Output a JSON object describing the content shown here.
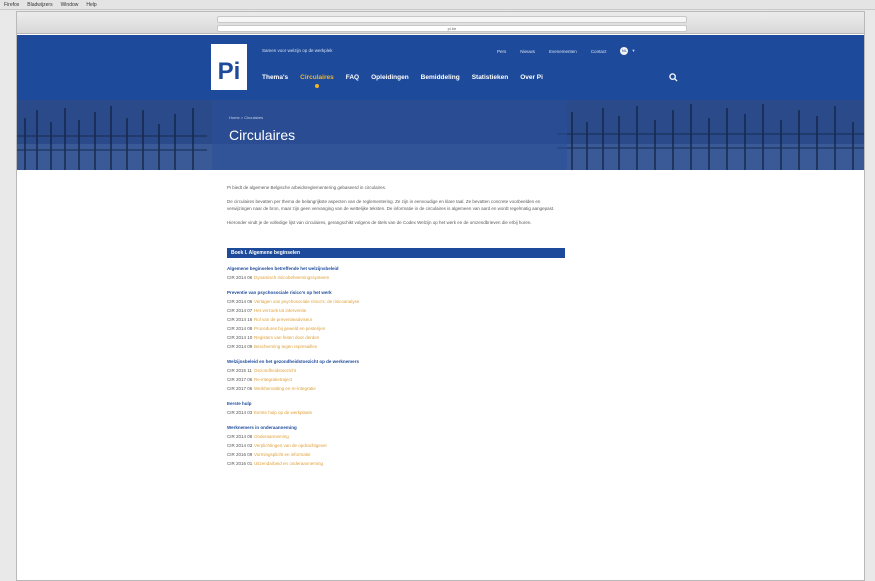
{
  "menubar": {
    "items": [
      "Firefox",
      "Bladwijzers",
      "Window",
      "Help"
    ]
  },
  "browser": {
    "url": "pi.be"
  },
  "header": {
    "logo": "Pi",
    "tagline": "Samen voor welzijn op de werkplek",
    "util_links": [
      "Pers",
      "Nieuws",
      "Evenementen",
      "Contact"
    ],
    "lang": "NL",
    "nav": [
      "Thema's",
      "Circulaires",
      "FAQ",
      "Opleidingen",
      "Bemiddeling",
      "Statistieken",
      "Over Pi"
    ],
    "active_index": 1
  },
  "hero": {
    "breadcrumb": "Home > Circulaires",
    "title": "Circulaires"
  },
  "intro": [
    "Pi biedt de algemene Belgische arbeidsreglementering gebaseerd in circulaires.",
    "De circulaires bevatten per thema de belangrijkste aspecten van de reglementering. Ze zijn in eenvoudige en klare taal. Ze bevatten concrete voorbeelden en verwijzingen naar de bron, maar zijn geen vervanging van de wettelijke teksten. De informatie in de circulaires is algemeen van aard en wordt regelmatig aangepast.",
    "Hieronder vindt je de volledige lijst van circulaires, gerangschikt volgens de titels van de Codex Welzijn op het werk en de omzendbrieven die erbij horen."
  ],
  "book": "Boek I. Algemene beginselen",
  "sections": [
    {
      "title": "Algemene beginselen betreffende het welzijnsbeleid",
      "rows": [
        {
          "code": "CIR 2014 06",
          "text": "Dynamisch risicobeheersingssysteem"
        }
      ]
    },
    {
      "title": "Preventie van psychosociale risico's op het werk",
      "rows": [
        {
          "code": "CIR 2014 06",
          "text": "Verlagen van psychosociale risico's: de risicoanalyse"
        },
        {
          "code": "CIR 2014 07",
          "text": "Het verzoek tot interventie"
        },
        {
          "code": "CIR 2014 16",
          "text": "Rol van de preventieadviseur"
        },
        {
          "code": "CIR 2014 08",
          "text": "Procedures bij geweld en pesterijen"
        },
        {
          "code": "CIR 2014 10",
          "text": "Registers van feiten door derden"
        },
        {
          "code": "CIR 2014 09",
          "text": "Bescherming tegen represailles"
        }
      ]
    },
    {
      "title": "Welzijnsbeleid en het gezondheidstoezicht op de werknemers",
      "rows": [
        {
          "code": "CIR 2015 11",
          "text": "Gezondheidstoezicht"
        },
        {
          "code": "CIR 2017 06",
          "text": "Re-integratietraject"
        },
        {
          "code": "CIR 2017 06",
          "text": "Werkhervatting en re-integratie"
        }
      ]
    },
    {
      "title": "Eerste hulp",
      "rows": [
        {
          "code": "CIR 2014 03",
          "text": "Eerste hulp op de werkplaats"
        }
      ]
    },
    {
      "title": "Werknemers in onderaanneming",
      "rows": [
        {
          "code": "CIR 2014 08",
          "text": "Onderaanneming"
        },
        {
          "code": "CIR 2014 03",
          "text": "Verplichtingen van de opdrachtgever"
        },
        {
          "code": "CIR 2016 09",
          "text": "Vormingsplicht en informatie"
        },
        {
          "code": "CIR 2016 01",
          "text": "Uitzendarbeid en onderaanneming"
        }
      ]
    }
  ],
  "colors": {
    "brand": "#1d4a9a",
    "accent": "#f0b429",
    "link": "#e0a13a"
  }
}
